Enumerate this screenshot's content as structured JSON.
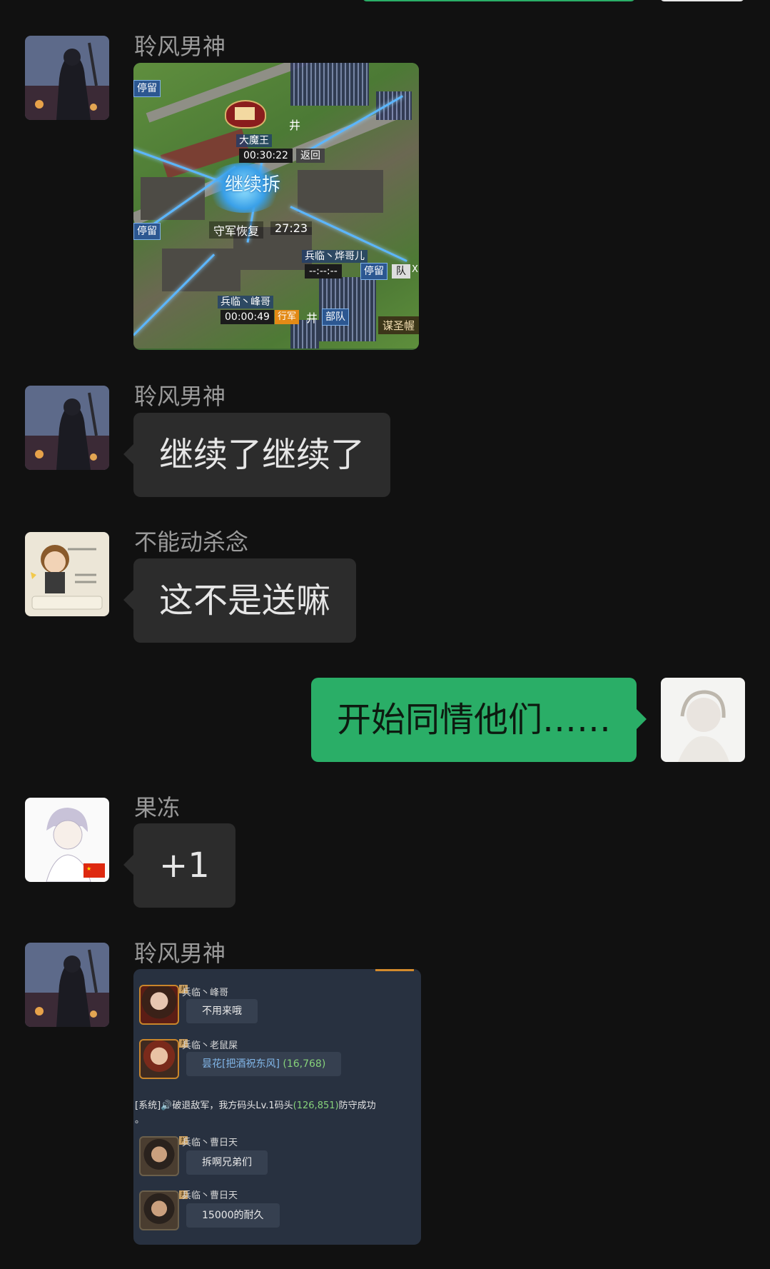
{
  "conversation": {
    "messages": [
      {
        "sender": "聆风男神",
        "type": "image",
        "avatar_icon": "ninja-warrior-avatar-icon"
      },
      {
        "sender": "聆风男神",
        "type": "text",
        "text": "继续了继续了",
        "avatar_icon": "ninja-warrior-avatar-icon"
      },
      {
        "sender": "不能动杀念",
        "type": "text",
        "text": "这不是送嘛",
        "avatar_icon": "cartoon-rookie-avatar-icon"
      },
      {
        "sender": "me",
        "type": "text",
        "text": "开始同情他们……",
        "avatar_icon": "sketch-girl-avatar-icon"
      },
      {
        "sender": "果冻",
        "type": "text",
        "text": "+1",
        "avatar_icon": "anime-boy-avatar-icon"
      },
      {
        "sender": "聆风男神",
        "type": "image",
        "avatar_icon": "ninja-warrior-avatar-icon"
      }
    ]
  },
  "map_screenshot": {
    "stay_tag_1": "停留",
    "stay_tag_2": "停留",
    "stay_tag_3": "停留",
    "well_1": "井",
    "well_2": "井",
    "well_3": "井",
    "boss_name": "大魔王",
    "boss_timer": "00:30:22",
    "boss_return": "返回",
    "center_text": "继续拆",
    "defense_label": "守军恢复",
    "defense_timer": "27:23",
    "player1_name": "兵临丶烨哥儿",
    "player1_timer": "--:--:--",
    "team_tag": "队",
    "close_mark": "X",
    "player2_name": "兵临丶峰哥",
    "player2_timer": "00:00:49",
    "march_tag": "行军",
    "army_tag": "部队",
    "corner_text": "谋圣幄"
  },
  "game_chat": {
    "badge": "井",
    "msg1_name": "兵临丶峰哥",
    "msg1_text": "不用来哦",
    "msg2_name": "兵临丶老鼠屎",
    "msg2_hl": "昙花[把酒祝东风]",
    "msg2_num": "(16,768)",
    "system_prefix": "[系统]🔊破退敌军，我方码头Lv.1码头",
    "system_num": "(126,851)",
    "system_suffix": "防守成功",
    "system_end": "。",
    "msg3_name": "兵临丶曹日天",
    "msg3_text": "拆啊兄弟们",
    "msg4_name": "兵临丶曹日天",
    "msg4_text": "15000的耐久"
  },
  "colors": {
    "background": "#111111",
    "bubble_other": "#2c2c2c",
    "bubble_self": "#2aae67",
    "sender_name": "#9a9a9a"
  }
}
